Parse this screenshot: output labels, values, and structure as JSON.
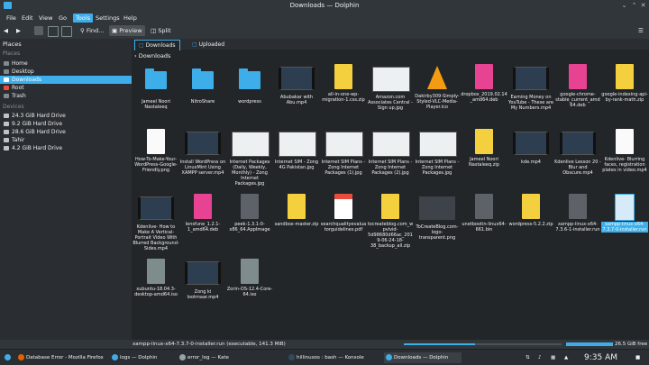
{
  "window": {
    "title": "Downloads — Dolphin"
  },
  "menubar": [
    "File",
    "Edit",
    "View",
    "Go",
    "Tools",
    "Settings",
    "Help"
  ],
  "toolbar": {
    "find": "Find...",
    "preview": "Preview",
    "split": "Split"
  },
  "places": {
    "panel_title": "Places",
    "section_places": "Places",
    "items": [
      {
        "label": "Home",
        "selected": false
      },
      {
        "label": "Desktop",
        "selected": false
      },
      {
        "label": "Downloads",
        "selected": true
      },
      {
        "label": "Root",
        "selected": false
      },
      {
        "label": "Trash",
        "selected": false
      }
    ],
    "section_devices": "Devices",
    "devices": [
      "24.3 GiB Hard Drive",
      "9.2 GiB Hard Drive",
      "28.6 GiB Hard Drive",
      "Tahir",
      "4.2 GiB Hard Drive"
    ]
  },
  "tabs": [
    "Downloads",
    "Uploaded"
  ],
  "breadcrumb": "Downloads",
  "files": [
    {
      "name": "Jameel Noori Nastaleeq",
      "kind": "folder"
    },
    {
      "name": "NitroShare",
      "kind": "folder"
    },
    {
      "name": "wordpress",
      "kind": "folder"
    },
    {
      "name": "Abubakar with Abu.mp4",
      "kind": "video"
    },
    {
      "name": "all-in-one-wp-migration-1.css.zip",
      "kind": "archive"
    },
    {
      "name": "Amazon.com Associates Central - Sign up.jpg",
      "kind": "image"
    },
    {
      "name": "Dakirby309-Simply-Styled-VLC-Media-Player.ico",
      "kind": "vlc"
    },
    {
      "name": "dropbox_2019.02.14_amd64.deb",
      "kind": "deb"
    },
    {
      "name": "Earning Money on YouTube - These are My Numbers.mp4",
      "kind": "video"
    },
    {
      "name": "google-chrome-stable_current_amd64.deb",
      "kind": "deb"
    },
    {
      "name": "google-indexing-api-by-rank-math.zip",
      "kind": "archive"
    },
    {
      "name": "How-To-Make-Your-WordPress-Google-Friendly.png",
      "kind": "doc"
    },
    {
      "name": "Install WordPress on LinuxMint Using XAMPP server.mp4",
      "kind": "video"
    },
    {
      "name": "Internet Packages (Daily, Weekly, Monthly) - Zong Internet Packages.jpg",
      "kind": "image"
    },
    {
      "name": "Internet SIM - Zong 4G Pakistan.jpg",
      "kind": "image"
    },
    {
      "name": "Internet SIM Plans - Zong Internet Packages (1).jpg",
      "kind": "image"
    },
    {
      "name": "Internet SIM Plans - Zong Internet Packages (2).jpg",
      "kind": "image"
    },
    {
      "name": "Internet SIM Plans - Zong Internet Packages.jpg",
      "kind": "image"
    },
    {
      "name": "Jameel Noori Nastaleeq.zip",
      "kind": "archive"
    },
    {
      "name": "kde.mp4",
      "kind": "video"
    },
    {
      "name": "Kdenlive Lesson 20 - Blur and Obscure.mp4",
      "kind": "video"
    },
    {
      "name": "Kdenlive- Blurring faces, registration plates in video.mp4",
      "kind": "doc"
    },
    {
      "name": "Kdenlive- How to Make A Vertical-Portrait Video With Blurred Background-Sides.mp4",
      "kind": "video"
    },
    {
      "name": "lensfune_1.2.1-1_amd64.deb",
      "kind": "deb"
    },
    {
      "name": "peek-1.3.1-0-x86_64.AppImage",
      "kind": "generic"
    },
    {
      "name": "sandbox-master.zip",
      "kind": "archive"
    },
    {
      "name": "searchqualityevaluatorguidelines.pdf",
      "kind": "pdf"
    },
    {
      "name": "tocreateblog.com_wpvivid-5d98680d66ac_2019-06-24-18-38_backup_all.zip",
      "kind": "archive"
    },
    {
      "name": "ToCreateBlog.com-logo-transparent.png",
      "kind": "logo"
    },
    {
      "name": "unetbootin-linux64-661.bin",
      "kind": "generic"
    },
    {
      "name": "wordpress-5.2.2.zip",
      "kind": "archive"
    },
    {
      "name": "xampp-linux-x64-7.3.6-1-installer.run",
      "kind": "generic"
    },
    {
      "name": "xampp-linux-x64-7.3.7-0-installer.run",
      "kind": "run",
      "selected": true
    },
    {
      "name": "xubuntu-18.04.3-desktop-amd64.iso",
      "kind": "iso"
    },
    {
      "name": "Zong ki lootmaar.mp4",
      "kind": "video"
    },
    {
      "name": "Zorin-OS-12.4-Core-64.iso",
      "kind": "iso"
    }
  ],
  "status": {
    "text": "xampp-linux-x64-7.3.7-0-installer.run (executable, 141.3 MiB)",
    "free": "26.5 GiB free",
    "zoom_fraction": 0.45
  },
  "taskbar": {
    "tasks": [
      {
        "label": "Database Error - Mozilla Firefox",
        "color": "#e66000"
      },
      {
        "label": "logs — Dolphin",
        "color": "#3daee9"
      },
      {
        "label": "error_log — Kate",
        "color": "#95a5a6"
      },
      {
        "label": "hillinuxos : bash — Konsole",
        "color": "#34495e"
      },
      {
        "label": "Downloads — Dolphin",
        "color": "#3daee9",
        "active": true
      }
    ],
    "clock": "9:35 AM"
  },
  "colors": {
    "accent": "#3daee9",
    "archive": "#f4d03f",
    "deb": "#e84393",
    "pdf": "#e74c3c",
    "iso": "#7f8c8d"
  }
}
